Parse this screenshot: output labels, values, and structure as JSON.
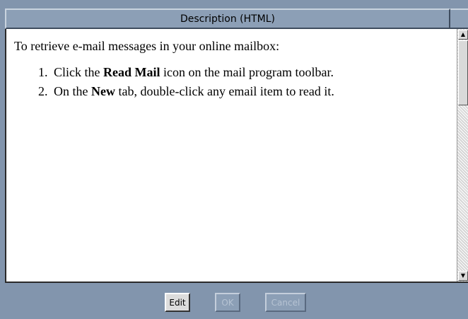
{
  "window": {
    "title": "Description (HTML)"
  },
  "content": {
    "intro": "To retrieve e-mail messages in your online mailbox:",
    "steps": [
      {
        "number": "1.",
        "before": "Click the ",
        "bold": "Read Mail",
        "after": " icon on the mail program toolbar."
      },
      {
        "number": "2.",
        "before": "On the ",
        "bold": "New",
        "after": " tab, double-click any email item to read it."
      }
    ]
  },
  "scrollbar": {
    "up_icon": "arrow-up-icon",
    "down_icon": "arrow-down-icon"
  },
  "buttons": {
    "edit": {
      "label": "Edit",
      "enabled": true
    },
    "ok": {
      "label": "OK",
      "enabled": false
    },
    "cancel": {
      "label": "Cancel",
      "enabled": false
    }
  },
  "colors": {
    "background": "#8295ad",
    "title_bar": "#8c9fb6",
    "content_background": "#ffffff",
    "disabled_text": "#b6c3d3"
  }
}
